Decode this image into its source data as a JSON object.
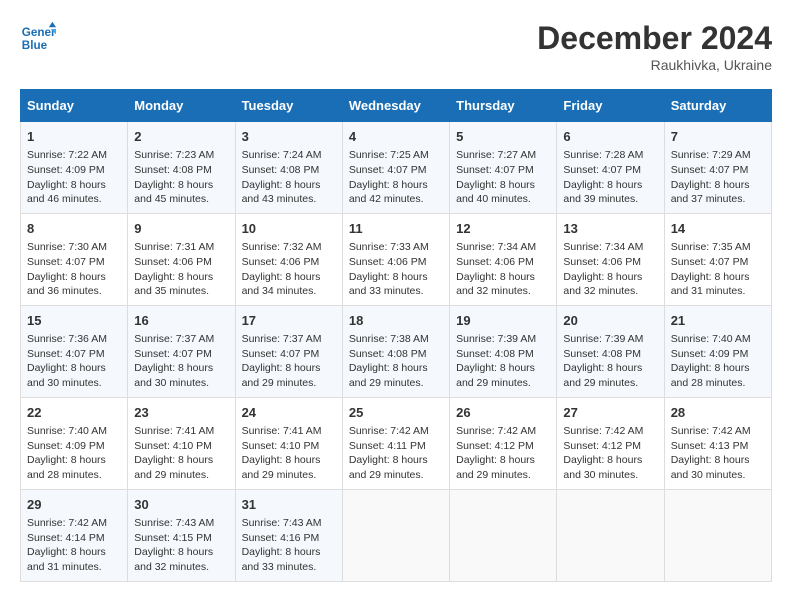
{
  "header": {
    "logo_line1": "General",
    "logo_line2": "Blue",
    "month": "December 2024",
    "location": "Raukhivka, Ukraine"
  },
  "weekdays": [
    "Sunday",
    "Monday",
    "Tuesday",
    "Wednesday",
    "Thursday",
    "Friday",
    "Saturday"
  ],
  "weeks": [
    [
      {
        "day": "1",
        "sunrise": "Sunrise: 7:22 AM",
        "sunset": "Sunset: 4:09 PM",
        "daylight": "Daylight: 8 hours and 46 minutes."
      },
      {
        "day": "2",
        "sunrise": "Sunrise: 7:23 AM",
        "sunset": "Sunset: 4:08 PM",
        "daylight": "Daylight: 8 hours and 45 minutes."
      },
      {
        "day": "3",
        "sunrise": "Sunrise: 7:24 AM",
        "sunset": "Sunset: 4:08 PM",
        "daylight": "Daylight: 8 hours and 43 minutes."
      },
      {
        "day": "4",
        "sunrise": "Sunrise: 7:25 AM",
        "sunset": "Sunset: 4:07 PM",
        "daylight": "Daylight: 8 hours and 42 minutes."
      },
      {
        "day": "5",
        "sunrise": "Sunrise: 7:27 AM",
        "sunset": "Sunset: 4:07 PM",
        "daylight": "Daylight: 8 hours and 40 minutes."
      },
      {
        "day": "6",
        "sunrise": "Sunrise: 7:28 AM",
        "sunset": "Sunset: 4:07 PM",
        "daylight": "Daylight: 8 hours and 39 minutes."
      },
      {
        "day": "7",
        "sunrise": "Sunrise: 7:29 AM",
        "sunset": "Sunset: 4:07 PM",
        "daylight": "Daylight: 8 hours and 37 minutes."
      }
    ],
    [
      {
        "day": "8",
        "sunrise": "Sunrise: 7:30 AM",
        "sunset": "Sunset: 4:07 PM",
        "daylight": "Daylight: 8 hours and 36 minutes."
      },
      {
        "day": "9",
        "sunrise": "Sunrise: 7:31 AM",
        "sunset": "Sunset: 4:06 PM",
        "daylight": "Daylight: 8 hours and 35 minutes."
      },
      {
        "day": "10",
        "sunrise": "Sunrise: 7:32 AM",
        "sunset": "Sunset: 4:06 PM",
        "daylight": "Daylight: 8 hours and 34 minutes."
      },
      {
        "day": "11",
        "sunrise": "Sunrise: 7:33 AM",
        "sunset": "Sunset: 4:06 PM",
        "daylight": "Daylight: 8 hours and 33 minutes."
      },
      {
        "day": "12",
        "sunrise": "Sunrise: 7:34 AM",
        "sunset": "Sunset: 4:06 PM",
        "daylight": "Daylight: 8 hours and 32 minutes."
      },
      {
        "day": "13",
        "sunrise": "Sunrise: 7:34 AM",
        "sunset": "Sunset: 4:06 PM",
        "daylight": "Daylight: 8 hours and 32 minutes."
      },
      {
        "day": "14",
        "sunrise": "Sunrise: 7:35 AM",
        "sunset": "Sunset: 4:07 PM",
        "daylight": "Daylight: 8 hours and 31 minutes."
      }
    ],
    [
      {
        "day": "15",
        "sunrise": "Sunrise: 7:36 AM",
        "sunset": "Sunset: 4:07 PM",
        "daylight": "Daylight: 8 hours and 30 minutes."
      },
      {
        "day": "16",
        "sunrise": "Sunrise: 7:37 AM",
        "sunset": "Sunset: 4:07 PM",
        "daylight": "Daylight: 8 hours and 30 minutes."
      },
      {
        "day": "17",
        "sunrise": "Sunrise: 7:37 AM",
        "sunset": "Sunset: 4:07 PM",
        "daylight": "Daylight: 8 hours and 29 minutes."
      },
      {
        "day": "18",
        "sunrise": "Sunrise: 7:38 AM",
        "sunset": "Sunset: 4:08 PM",
        "daylight": "Daylight: 8 hours and 29 minutes."
      },
      {
        "day": "19",
        "sunrise": "Sunrise: 7:39 AM",
        "sunset": "Sunset: 4:08 PM",
        "daylight": "Daylight: 8 hours and 29 minutes."
      },
      {
        "day": "20",
        "sunrise": "Sunrise: 7:39 AM",
        "sunset": "Sunset: 4:08 PM",
        "daylight": "Daylight: 8 hours and 29 minutes."
      },
      {
        "day": "21",
        "sunrise": "Sunrise: 7:40 AM",
        "sunset": "Sunset: 4:09 PM",
        "daylight": "Daylight: 8 hours and 28 minutes."
      }
    ],
    [
      {
        "day": "22",
        "sunrise": "Sunrise: 7:40 AM",
        "sunset": "Sunset: 4:09 PM",
        "daylight": "Daylight: 8 hours and 28 minutes."
      },
      {
        "day": "23",
        "sunrise": "Sunrise: 7:41 AM",
        "sunset": "Sunset: 4:10 PM",
        "daylight": "Daylight: 8 hours and 29 minutes."
      },
      {
        "day": "24",
        "sunrise": "Sunrise: 7:41 AM",
        "sunset": "Sunset: 4:10 PM",
        "daylight": "Daylight: 8 hours and 29 minutes."
      },
      {
        "day": "25",
        "sunrise": "Sunrise: 7:42 AM",
        "sunset": "Sunset: 4:11 PM",
        "daylight": "Daylight: 8 hours and 29 minutes."
      },
      {
        "day": "26",
        "sunrise": "Sunrise: 7:42 AM",
        "sunset": "Sunset: 4:12 PM",
        "daylight": "Daylight: 8 hours and 29 minutes."
      },
      {
        "day": "27",
        "sunrise": "Sunrise: 7:42 AM",
        "sunset": "Sunset: 4:12 PM",
        "daylight": "Daylight: 8 hours and 30 minutes."
      },
      {
        "day": "28",
        "sunrise": "Sunrise: 7:42 AM",
        "sunset": "Sunset: 4:13 PM",
        "daylight": "Daylight: 8 hours and 30 minutes."
      }
    ],
    [
      {
        "day": "29",
        "sunrise": "Sunrise: 7:42 AM",
        "sunset": "Sunset: 4:14 PM",
        "daylight": "Daylight: 8 hours and 31 minutes."
      },
      {
        "day": "30",
        "sunrise": "Sunrise: 7:43 AM",
        "sunset": "Sunset: 4:15 PM",
        "daylight": "Daylight: 8 hours and 32 minutes."
      },
      {
        "day": "31",
        "sunrise": "Sunrise: 7:43 AM",
        "sunset": "Sunset: 4:16 PM",
        "daylight": "Daylight: 8 hours and 33 minutes."
      },
      null,
      null,
      null,
      null
    ]
  ]
}
